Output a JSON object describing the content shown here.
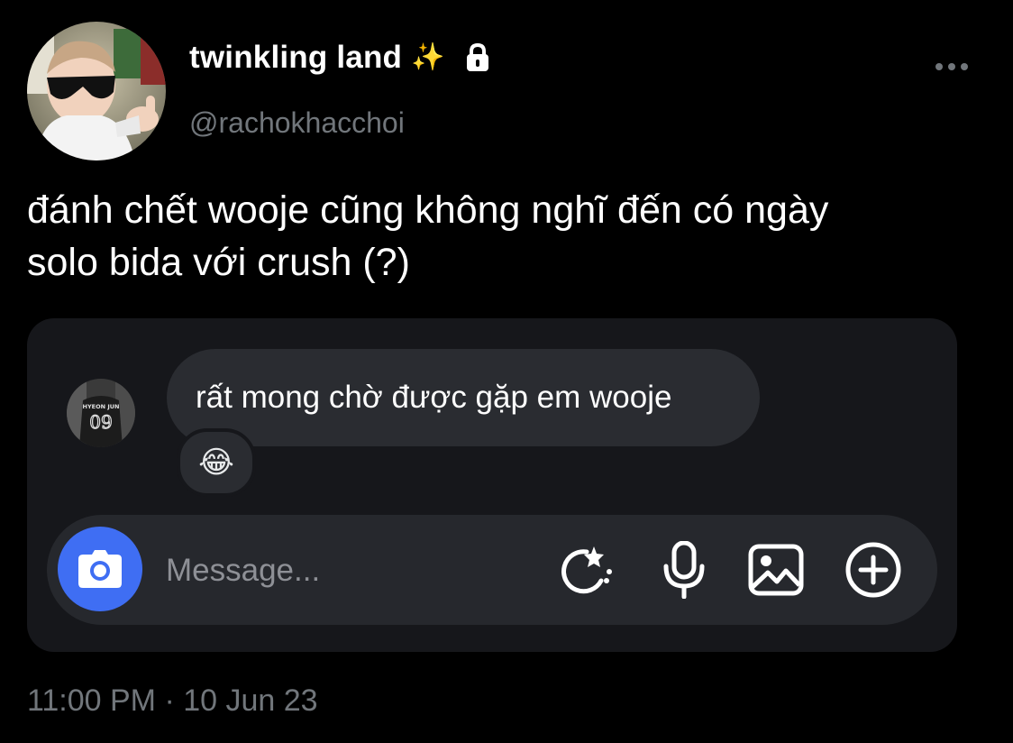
{
  "header": {
    "display_name": "twinkling land",
    "name_emoji": "✨",
    "handle": "@rachokhacchoi",
    "lock_icon": "lock-icon",
    "more_icon": "more-horizontal-icon"
  },
  "tweet": {
    "text": "đánh chết wooje cũng không nghĩ đến có ngày\nsolo bida với crush (?)",
    "timestamp": "11:00 PM · 10 Jun 23"
  },
  "embedded_chat": {
    "sender_avatar_text": {
      "name": "HYEON JUN",
      "number": "09"
    },
    "message": "rất mong chờ được gặp em wooje",
    "reaction": "😂",
    "composer": {
      "placeholder": "Message...",
      "icons": [
        "camera-icon",
        "sticker-icon",
        "microphone-icon",
        "gallery-icon",
        "add-circle-icon"
      ]
    }
  },
  "colors": {
    "background": "#000000",
    "text_primary": "#ffffff",
    "text_secondary": "#71767b",
    "card_bg": "#16171b",
    "bubble_bg": "#2a2c31",
    "camera_blue": "#3f6ef3"
  }
}
